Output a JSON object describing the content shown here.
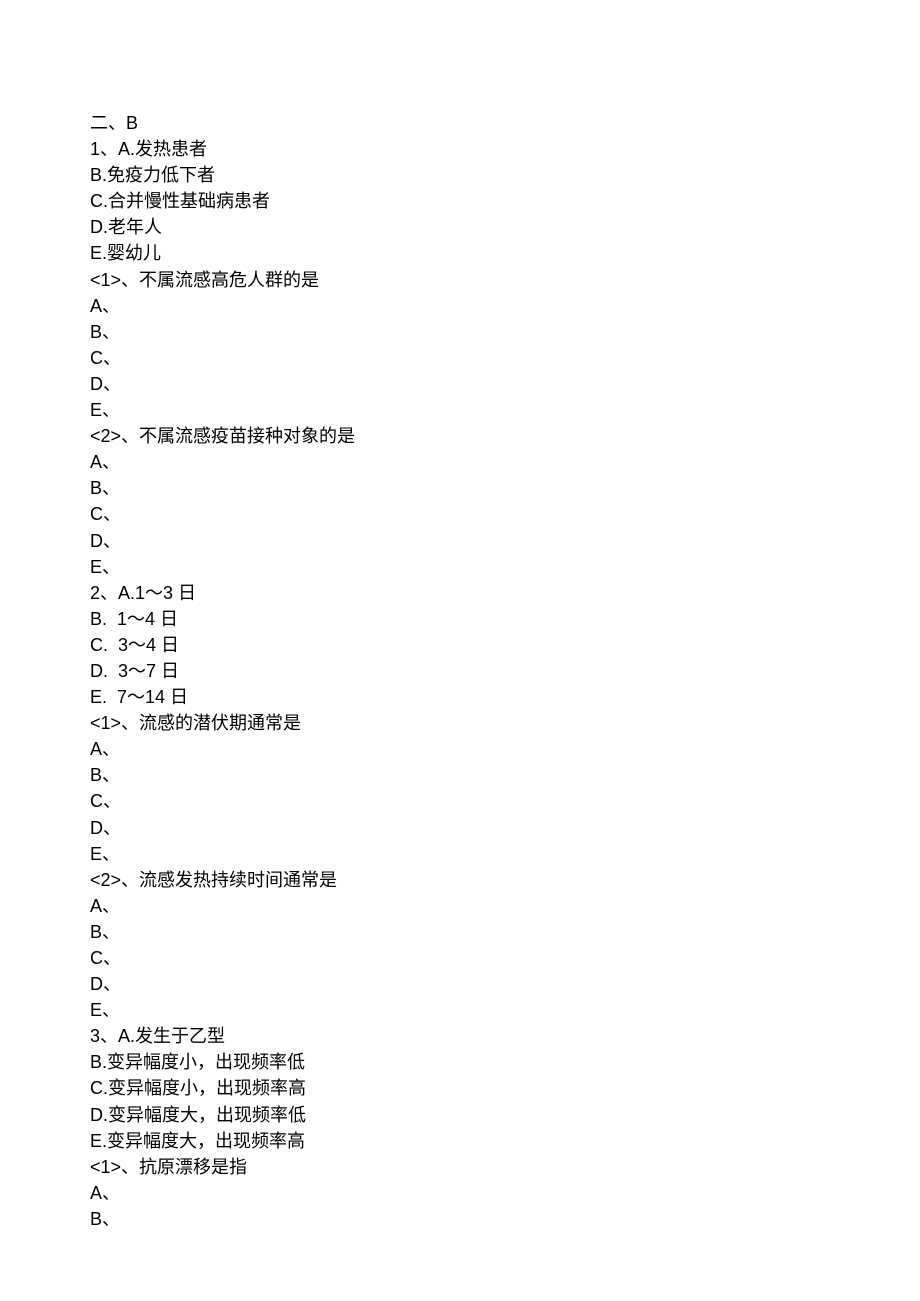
{
  "header": "二、B",
  "q1": {
    "stem": "1、A.发热患者",
    "optB": "B.免疫力低下者",
    "optC": "C.合并慢性基础病患者",
    "optD": "D.老年人",
    "optE": "E.婴幼儿",
    "sub1": "<1>、不属流感高危人群的是",
    "sub2": "<2>、不属流感疫苗接种对象的是"
  },
  "q2": {
    "stem": "2、A.1～3 日",
    "optB": "B.  1～4 日",
    "optC": "C.  3～4 日",
    "optD": "D.  3～7 日",
    "optE": "E.  7～14 日",
    "sub1": "<1>、流感的潜伏期通常是",
    "sub2": "<2>、流感发热持续时间通常是"
  },
  "q3": {
    "stem": "3、A.发生于乙型",
    "optB": "B.变异幅度小，出现频率低",
    "optC": "C.变异幅度小，出现频率高",
    "optD": "D.变异幅度大，出现频率低",
    "optE": "E.变异幅度大，出现频率高",
    "sub1": "<1>、抗原漂移是指"
  },
  "choices": {
    "A": "A、",
    "B": "B、",
    "C": "C、",
    "D": "D、",
    "E": "E、"
  }
}
